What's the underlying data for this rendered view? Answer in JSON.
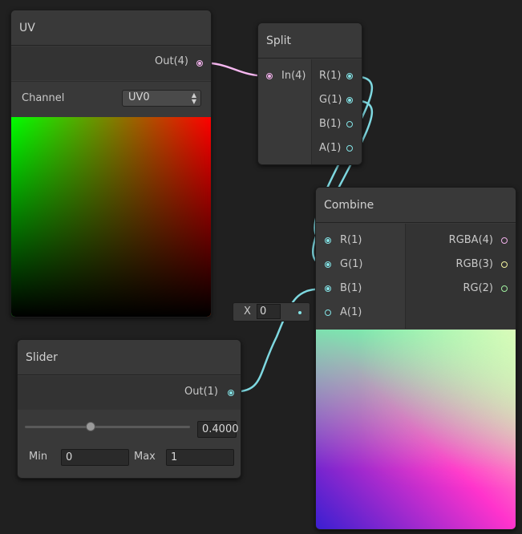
{
  "colors": {
    "canvas": "#202020",
    "node_bg": "#393939",
    "wire_vector": "#f6b7f0",
    "wire_float": "#7ed8e0",
    "port_vector4": "#f0b0ea",
    "port_vector3": "#f4f4a0",
    "port_vector2": "#a0f0a0",
    "port_float": "#84e4e7"
  },
  "uv_node": {
    "title": "UV",
    "output_label": "Out(4)",
    "channel_label": "Channel",
    "channel_value": "UV0"
  },
  "split_node": {
    "title": "Split",
    "input_label": "In(4)",
    "outputs": [
      "R(1)",
      "G(1)",
      "B(1)",
      "A(1)"
    ]
  },
  "combine_node": {
    "title": "Combine",
    "inputs": [
      "R(1)",
      "G(1)",
      "B(1)",
      "A(1)"
    ],
    "outputs": [
      "RGBA(4)",
      "RGB(3)",
      "RG(2)"
    ],
    "a_inline_label": "X",
    "a_inline_value": "0"
  },
  "slider_node": {
    "title": "Slider",
    "output_label": "Out(1)",
    "value": "0.4000",
    "slider_fraction": 0.4,
    "min_label": "Min",
    "min_value": "0",
    "max_label": "Max",
    "max_value": "1"
  },
  "icons": {
    "dropdown": "updown-arrows-icon",
    "port": "port-circle-icon"
  }
}
